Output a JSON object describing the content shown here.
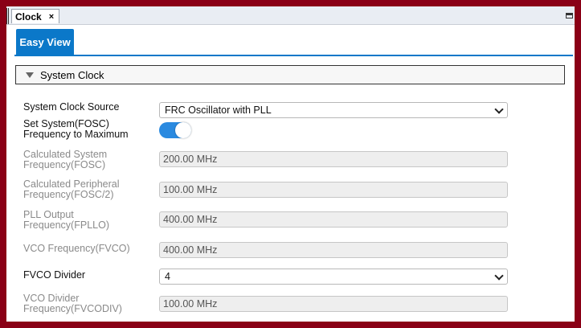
{
  "tabs": {
    "document_tab": "Clock",
    "close_glyph": "×"
  },
  "view_tab": "Easy View",
  "section": {
    "title": "System Clock"
  },
  "rows": {
    "clock_source_label": "System Clock Source",
    "clock_source_value": "FRC Oscillator with PLL",
    "set_max_label": "Set System(FOSC) Frequency to Maximum",
    "set_max_on": true,
    "calc_system_label": "Calculated System Frequency(FOSC)",
    "calc_system_value": "200.00 MHz",
    "calc_periph_label": "Calculated Peripheral Frequency(FOSC/2)",
    "calc_periph_value": "100.00 MHz",
    "pll_output_label": "PLL Output Frequency(FPLLO)",
    "pll_output_value": "400.00 MHz",
    "vco_freq_label": "VCO Frequency(FVCO)",
    "vco_freq_value": "400.00 MHz",
    "fvco_divider_label": "FVCO Divider",
    "fvco_divider_value": "4",
    "vco_div_freq_label": "VCO Divider Frequency(FVCODIV)",
    "vco_div_freq_value": "100.00 MHz"
  },
  "colors": {
    "accent": "#0b78c9",
    "toggle_on": "#2a8ae0",
    "frame": "#8a0016"
  }
}
